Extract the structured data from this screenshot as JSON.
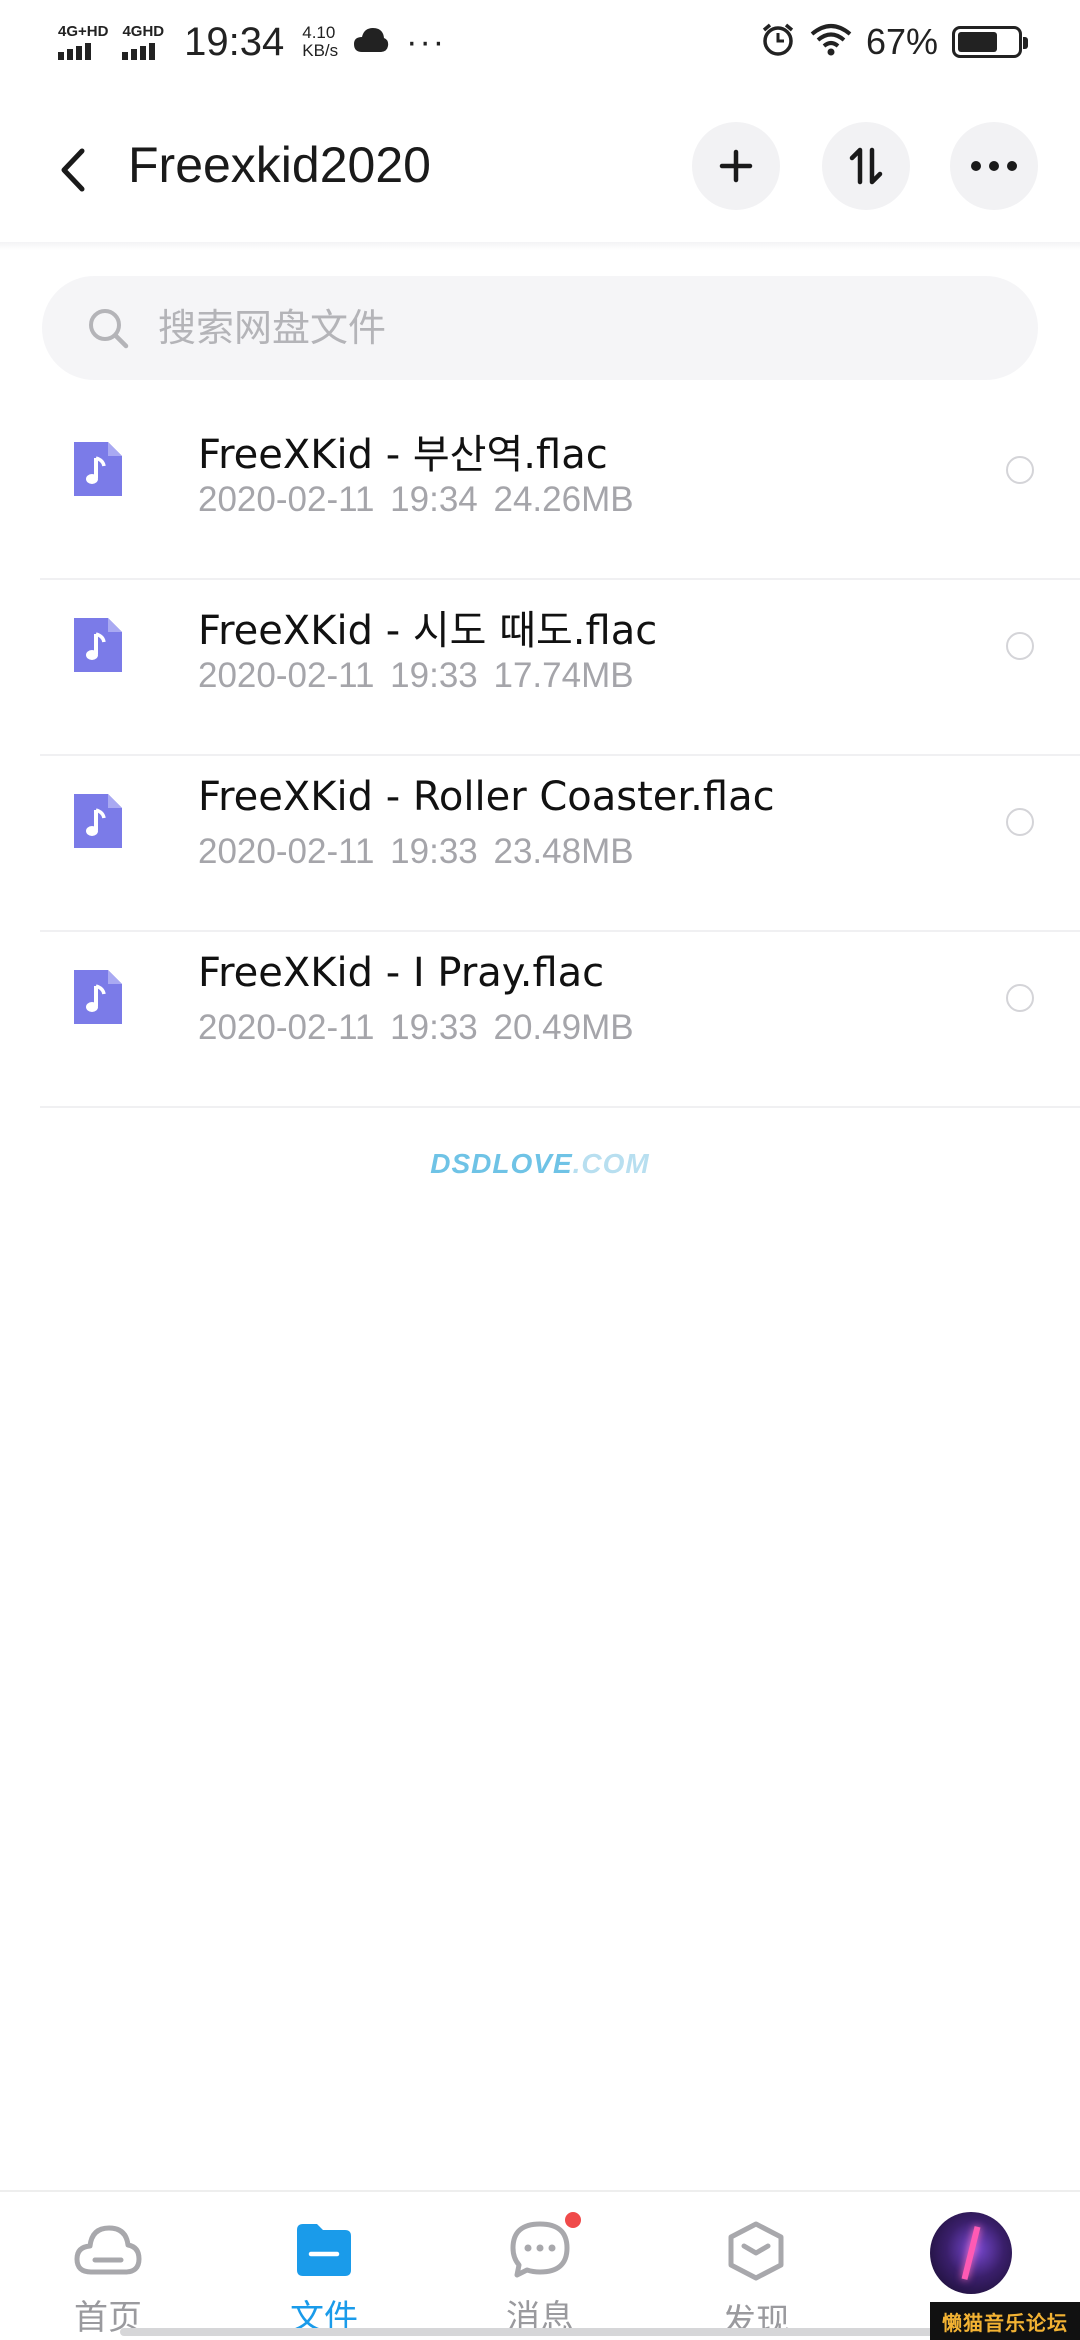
{
  "status_bar": {
    "network1": "4G+HD",
    "network2": "4GHD",
    "time": "19:34",
    "speed_value": "4.10",
    "speed_unit": "KB/s",
    "more": "···",
    "battery": "67%",
    "battery_level": 0.67,
    "icons": [
      "signal-icon",
      "cloud-icon",
      "alarm-icon",
      "wifi-icon",
      "battery-icon"
    ]
  },
  "header": {
    "title": "Freexkid2020",
    "icons": [
      "back-arrow-icon",
      "plus-icon",
      "sort-icon",
      "more-icon"
    ]
  },
  "search": {
    "placeholder": "搜索网盘文件",
    "value": ""
  },
  "files": [
    {
      "name": "FreeXKid - 부산역.flac",
      "date": "2020-02-11",
      "time": "19:34",
      "size": "24.26MB"
    },
    {
      "name": "FreeXKid - 시도 때도.flac",
      "date": "2020-02-11",
      "time": "19:33",
      "size": "17.74MB"
    },
    {
      "name": "FreeXKid - Roller Coaster.flac",
      "date": "2020-02-11",
      "time": "19:33",
      "size": "23.48MB"
    },
    {
      "name": "FreeXKid - I Pray.flac",
      "date": "2020-02-11",
      "time": "19:33",
      "size": "20.49MB"
    }
  ],
  "watermark": {
    "main": "DSDLOVE",
    "suffix": ".COM"
  },
  "bottom_nav": {
    "items": [
      {
        "label": "首页",
        "icon": "cloud-home-icon",
        "active": false
      },
      {
        "label": "文件",
        "icon": "folder-icon",
        "active": true
      },
      {
        "label": "消息",
        "icon": "message-icon",
        "active": false,
        "badge": true
      },
      {
        "label": "发现",
        "icon": "discover-icon",
        "active": false
      }
    ]
  },
  "forum_logo": "懒猫音乐论坛",
  "colors": {
    "accent": "#1a9bea",
    "file_icon": "#7b7be8",
    "badge": "#f04a4a"
  }
}
